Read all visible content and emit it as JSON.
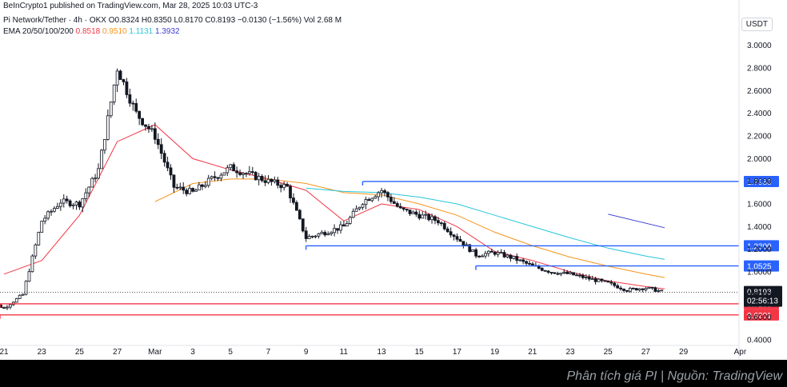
{
  "header": {
    "published": "BeInCrypto1 published on TradingView.com, Mar 28, 2025 10:03 UTC-3",
    "symbol": "Pi Network/Tether · 4h · OKX",
    "ohlc": "O0.8324 H0.8350 L0.8170 C0.8193 −0.0130 (−1.56%) Vol 2.68 M",
    "ema_label": "EMA 20/50/100/200",
    "ema_values": [
      "0.8518",
      "0.9510",
      "1.1131",
      "1.3932"
    ]
  },
  "currency_label": "USDT",
  "caption": "Phân tích giá PI | Nguồn: TradingView",
  "colors": {
    "up": "#131722",
    "down": "#131722",
    "ema20": "#f23645",
    "ema50": "#f7931a",
    "ema100": "#26c6da",
    "ema200": "#3d3dd6",
    "blue_level": "#2962ff",
    "red_level": "#f23645"
  },
  "chart_data": {
    "type": "candlestick",
    "title": "",
    "xlabel": "",
    "ylabel": "",
    "ylim": [
      0.4,
      3.1
    ],
    "y_ticks": [
      "0.4000",
      "0.6000",
      "0.8000",
      "1.0000",
      "1.2000",
      "1.4000",
      "1.6000",
      "1.8000",
      "2.0000",
      "2.2000",
      "2.4000",
      "2.6000",
      "2.8000",
      "3.0000"
    ],
    "x_ticks": [
      "21",
      "23",
      "25",
      "27",
      "Mar",
      "3",
      "5",
      "7",
      "9",
      "11",
      "13",
      "15",
      "17",
      "19",
      "21",
      "23",
      "25",
      "27",
      "29",
      "Apr"
    ],
    "price_path": [
      {
        "date": "Feb 20",
        "value": 0.75
      },
      {
        "date": "Feb 21",
        "value": 0.68
      },
      {
        "date": "Feb 22",
        "value": 0.8
      },
      {
        "date": "Feb 23",
        "value": 1.45
      },
      {
        "date": "Feb 24",
        "value": 1.62
      },
      {
        "date": "Feb 25",
        "value": 1.6
      },
      {
        "date": "Feb 26",
        "value": 1.9
      },
      {
        "date": "Feb 27",
        "value": 2.8
      },
      {
        "date": "Feb 28",
        "value": 2.4
      },
      {
        "date": "Mar 1",
        "value": 2.2
      },
      {
        "date": "Mar 2",
        "value": 1.75
      },
      {
        "date": "Mar 3",
        "value": 1.7
      },
      {
        "date": "Mar 4",
        "value": 1.82
      },
      {
        "date": "Mar 5",
        "value": 1.92
      },
      {
        "date": "Mar 6",
        "value": 1.86
      },
      {
        "date": "Mar 7",
        "value": 1.8
      },
      {
        "date": "Mar 8",
        "value": 1.75
      },
      {
        "date": "Mar 9",
        "value": 1.3
      },
      {
        "date": "Mar 10",
        "value": 1.35
      },
      {
        "date": "Mar 11",
        "value": 1.4
      },
      {
        "date": "Mar 12",
        "value": 1.62
      },
      {
        "date": "Mar 13",
        "value": 1.72
      },
      {
        "date": "Mar 14",
        "value": 1.55
      },
      {
        "date": "Mar 15",
        "value": 1.5
      },
      {
        "date": "Mar 16",
        "value": 1.45
      },
      {
        "date": "Mar 17",
        "value": 1.3
      },
      {
        "date": "Mar 18",
        "value": 1.15
      },
      {
        "date": "Mar 19",
        "value": 1.17
      },
      {
        "date": "Mar 20",
        "value": 1.12
      },
      {
        "date": "Mar 21",
        "value": 1.05
      },
      {
        "date": "Mar 22",
        "value": 1.0
      },
      {
        "date": "Mar 23",
        "value": 0.98
      },
      {
        "date": "Mar 24",
        "value": 0.94
      },
      {
        "date": "Mar 25",
        "value": 0.9
      },
      {
        "date": "Mar 26",
        "value": 0.84
      },
      {
        "date": "Mar 27",
        "value": 0.86
      },
      {
        "date": "Mar 28",
        "value": 0.82
      }
    ],
    "ema_lines": [
      {
        "name": "EMA 20",
        "color": "#f23645",
        "values": [
          {
            "date": "Feb 21",
            "value": 0.98
          },
          {
            "date": "Feb 23",
            "value": 1.1
          },
          {
            "date": "Feb 25",
            "value": 1.5
          },
          {
            "date": "Feb 27",
            "value": 2.15
          },
          {
            "date": "Mar 1",
            "value": 2.3
          },
          {
            "date": "Mar 3",
            "value": 2.0
          },
          {
            "date": "Mar 5",
            "value": 1.9
          },
          {
            "date": "Mar 7",
            "value": 1.82
          },
          {
            "date": "Mar 9",
            "value": 1.72
          },
          {
            "date": "Mar 11",
            "value": 1.45
          },
          {
            "date": "Mar 13",
            "value": 1.6
          },
          {
            "date": "Mar 15",
            "value": 1.55
          },
          {
            "date": "Mar 17",
            "value": 1.4
          },
          {
            "date": "Mar 19",
            "value": 1.18
          },
          {
            "date": "Mar 21",
            "value": 1.1
          },
          {
            "date": "Mar 23",
            "value": 1.0
          },
          {
            "date": "Mar 25",
            "value": 0.92
          },
          {
            "date": "Mar 27",
            "value": 0.87
          },
          {
            "date": "Mar 28",
            "value": 0.85
          }
        ]
      },
      {
        "name": "EMA 50",
        "color": "#f7931a",
        "values": [
          {
            "date": "Mar 1",
            "value": 1.62
          },
          {
            "date": "Mar 3",
            "value": 1.78
          },
          {
            "date": "Mar 5",
            "value": 1.82
          },
          {
            "date": "Mar 7",
            "value": 1.82
          },
          {
            "date": "Mar 9",
            "value": 1.78
          },
          {
            "date": "Mar 11",
            "value": 1.7
          },
          {
            "date": "Mar 13",
            "value": 1.68
          },
          {
            "date": "Mar 15",
            "value": 1.6
          },
          {
            "date": "Mar 17",
            "value": 1.5
          },
          {
            "date": "Mar 19",
            "value": 1.35
          },
          {
            "date": "Mar 21",
            "value": 1.23
          },
          {
            "date": "Mar 23",
            "value": 1.13
          },
          {
            "date": "Mar 25",
            "value": 1.05
          },
          {
            "date": "Mar 27",
            "value": 0.98
          },
          {
            "date": "Mar 28",
            "value": 0.95
          }
        ]
      },
      {
        "name": "EMA 100",
        "color": "#26c6da",
        "values": [
          {
            "date": "Mar 9",
            "value": 1.74
          },
          {
            "date": "Mar 11",
            "value": 1.71
          },
          {
            "date": "Mar 13",
            "value": 1.7
          },
          {
            "date": "Mar 15",
            "value": 1.66
          },
          {
            "date": "Mar 17",
            "value": 1.6
          },
          {
            "date": "Mar 19",
            "value": 1.5
          },
          {
            "date": "Mar 21",
            "value": 1.4
          },
          {
            "date": "Mar 23",
            "value": 1.3
          },
          {
            "date": "Mar 25",
            "value": 1.21
          },
          {
            "date": "Mar 27",
            "value": 1.14
          },
          {
            "date": "Mar 28",
            "value": 1.11
          }
        ]
      },
      {
        "name": "EMA 200",
        "color": "#3d3dd6",
        "values": [
          {
            "date": "Mar 25",
            "value": 1.51
          },
          {
            "date": "Mar 28",
            "value": 1.39
          }
        ]
      }
    ],
    "levels": [
      {
        "label": "1.7980",
        "value": 1.798,
        "color": "#2962ff",
        "from": "Mar 12"
      },
      {
        "label": "1.2300",
        "value": 1.23,
        "color": "#2962ff",
        "from": "Mar 9"
      },
      {
        "label": "1.0525",
        "value": 1.0525,
        "color": "#2962ff",
        "from": "Mar 18"
      },
      {
        "label": "0.7183",
        "value": 0.7183,
        "color": "#f23645",
        "from": "Feb 20"
      },
      {
        "label": "0.6201",
        "value": 0.6201,
        "color": "#f23645",
        "from": "Feb 20"
      }
    ],
    "current_price": {
      "label": "0.8193",
      "value": 0.8193,
      "countdown": "02:56:13"
    }
  }
}
